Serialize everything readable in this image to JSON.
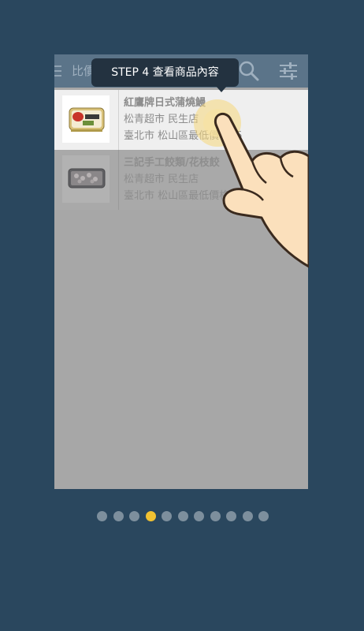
{
  "app_bar": {
    "title": "比價搜尋",
    "menu_icon": "menu-icon",
    "search_icon": "search-icon",
    "filter_icon": "filter-sliders-icon",
    "color": "#5b7489"
  },
  "tooltip": {
    "text": "STEP 4  查看商品內容",
    "color": "#233240"
  },
  "results": [
    {
      "name": "紅鷹牌日式蒲燒鰻",
      "store": "松青超市 民生店",
      "price_line": "臺北市 松山區最低價格45"
    },
    {
      "name": "三記手工餃類/花枝餃",
      "store": "松青超市 民生店",
      "price_line": "臺北市 松山區最低價格65"
    }
  ],
  "pagination": {
    "total": 11,
    "current_index": 3,
    "active_color": "#f1c232",
    "inactive_color": "#7d8f9d"
  }
}
